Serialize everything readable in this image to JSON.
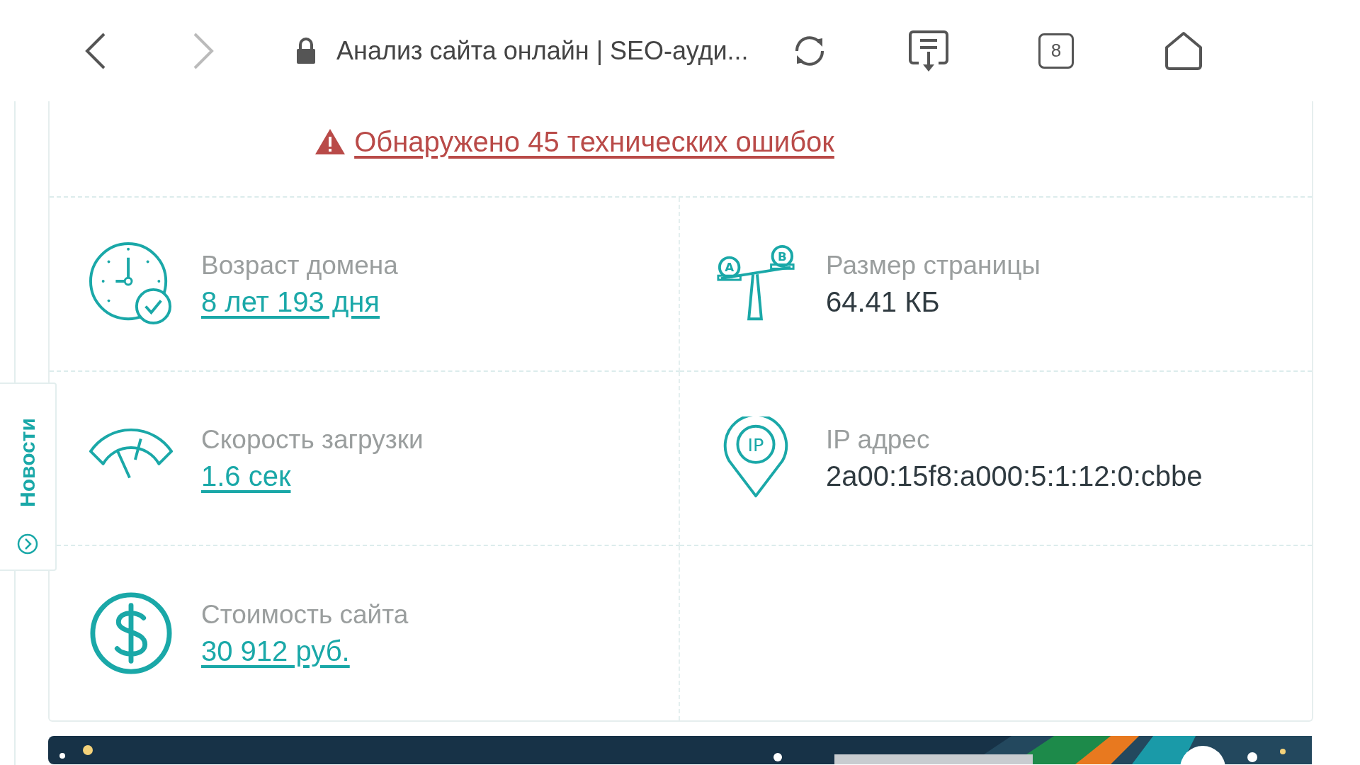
{
  "toolbar": {
    "page_title": "Анализ сайта онлайн | SEO-ауди...",
    "tab_count": "8"
  },
  "alert": {
    "text": "Обнаружено 45 технических ошибок"
  },
  "side_tab": {
    "label": "Новости"
  },
  "metrics": [
    {
      "kind": "clock",
      "label": "Возраст домена",
      "value": "8 лет 193 дня",
      "link": true
    },
    {
      "kind": "scale",
      "label": "Размер страницы",
      "value": "64.41 КБ",
      "link": false,
      "icon_labels": [
        "A",
        "B"
      ]
    },
    {
      "kind": "gauge",
      "label": "Скорость загрузки",
      "value": "1.6 сек",
      "link": true
    },
    {
      "kind": "pin",
      "label": "IP адрес",
      "value": "2a00:15f8:a000:5:1:12:0:cbbe",
      "link": false,
      "icon_labels": [
        "IP"
      ]
    },
    {
      "kind": "dollar",
      "label": "Стоимость сайта",
      "value": "30 912 руб.",
      "link": true
    }
  ]
}
